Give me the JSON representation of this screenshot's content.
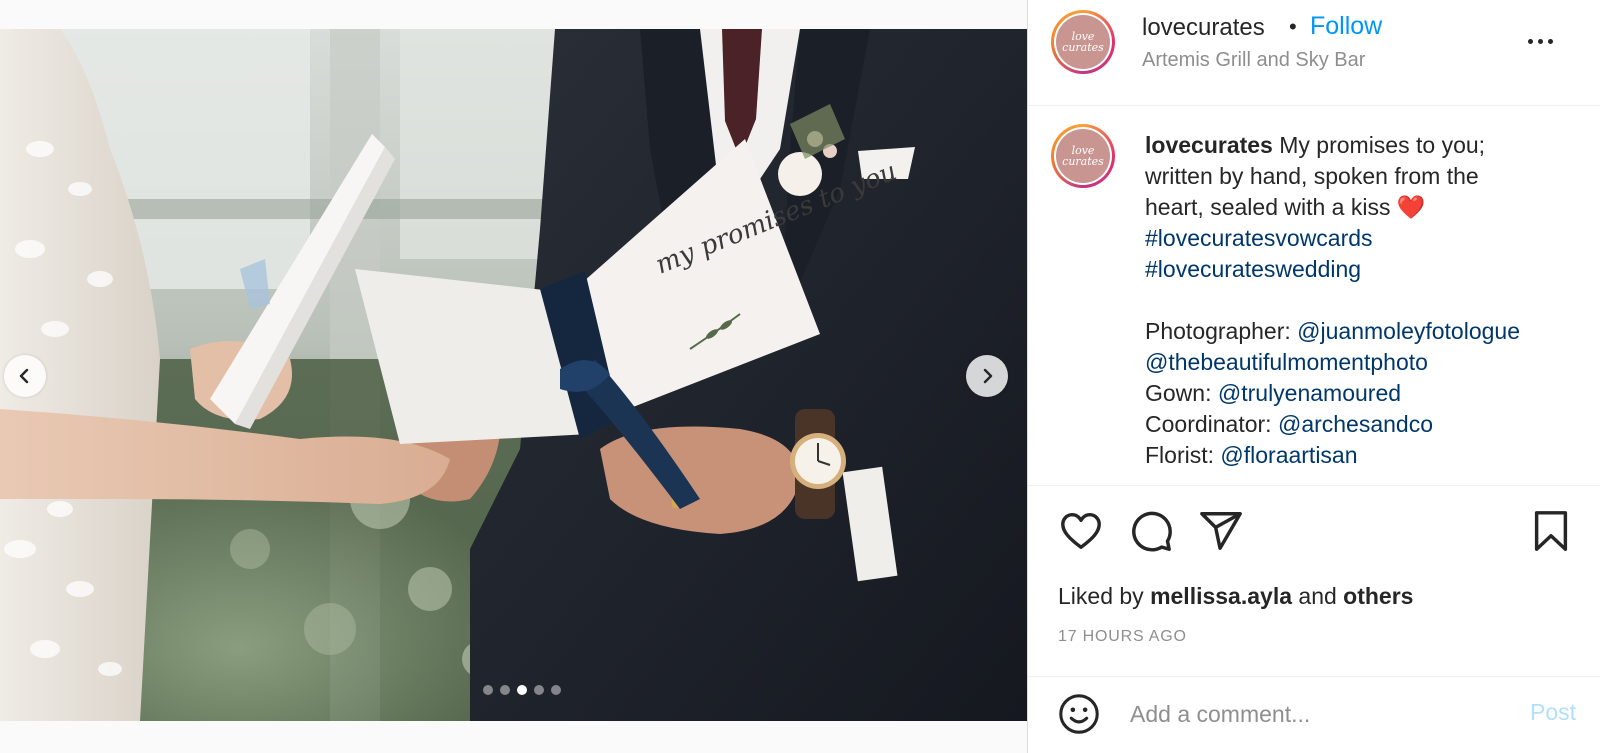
{
  "post": {
    "username": "lovecurates",
    "separator": "•",
    "follow_label": "Follow",
    "location": "Artemis Grill and Sky Bar",
    "avatar_text": "love curates"
  },
  "caption": {
    "username": "lovecurates",
    "line1": "My promises to you;",
    "line2": "written by hand, spoken from the",
    "line3": "heart, sealed with a kiss",
    "heart": "❤️",
    "hashtag1": "#lovecuratesvowcards",
    "hashtag2": "#lovecurateswedding",
    "credits": [
      {
        "label": "Photographer: ",
        "handle": "@juanmoleyfotologue"
      },
      {
        "label": "",
        "handle": "@thebeautifulmomentphoto"
      },
      {
        "label": "Gown: ",
        "handle": "@trulyenamoured"
      },
      {
        "label": "Coordinator: ",
        "handle": "@archesandco"
      },
      {
        "label": "Florist: ",
        "handle": "@floraartisan"
      }
    ]
  },
  "photo": {
    "card_text": "my promises to you",
    "carousel_count": 5,
    "carousel_active": 3
  },
  "actions": {
    "icons": [
      "heart-icon",
      "comment-icon",
      "share-icon",
      "bookmark-icon"
    ]
  },
  "likes": {
    "prefix": "Liked by ",
    "user": "mellissa.ayla",
    "middle": " and ",
    "others": "others"
  },
  "timestamp": "17 HOURS AGO",
  "comment": {
    "placeholder": "Add a comment...",
    "post_label": "Post"
  },
  "colors": {
    "link": "#00376b",
    "follow": "#0095f6",
    "post_disabled": "#b2dffc",
    "muted": "#8e8e8e"
  }
}
